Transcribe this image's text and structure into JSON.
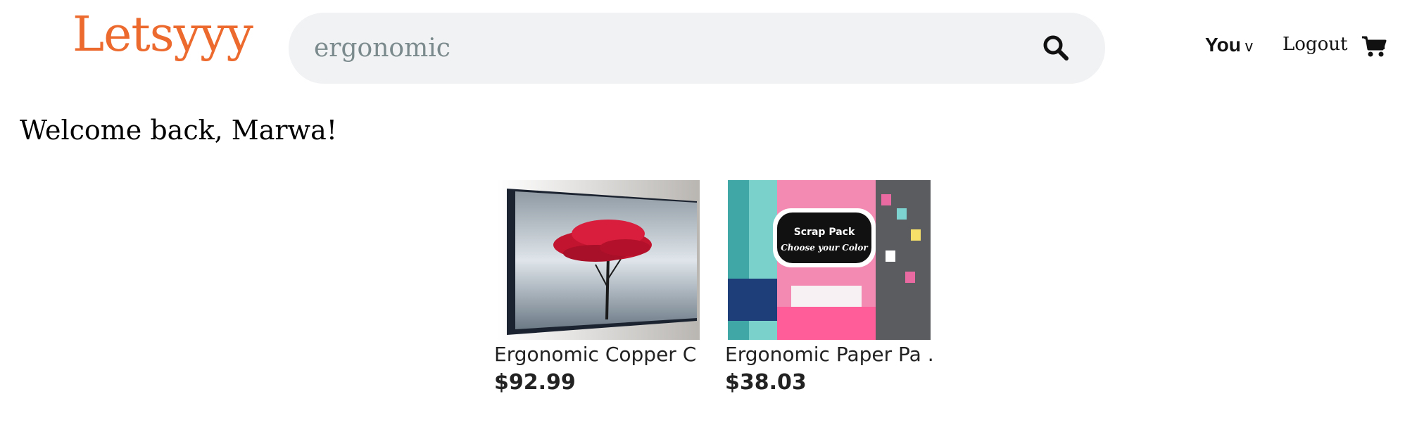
{
  "header": {
    "logo": "Letsyyy",
    "search": {
      "value": "ergonomic",
      "icon": "search-icon"
    },
    "you_label": "You",
    "you_chevron": "v",
    "logout_label": "Logout",
    "cart_icon": "cart-icon",
    "brand_color": "#ed6a2e"
  },
  "welcome": "Welcome back, Marwa!",
  "products": [
    {
      "title": "Ergonomic Copper C ...",
      "price": "$92.99",
      "image": "red-tree-canvas-painting"
    },
    {
      "title": "Ergonomic Paper Pa ...",
      "price": "$38.03",
      "image": "fabric-scrap-pack",
      "image_text": [
        "Scrap Pack",
        "Choose your Color"
      ]
    }
  ]
}
